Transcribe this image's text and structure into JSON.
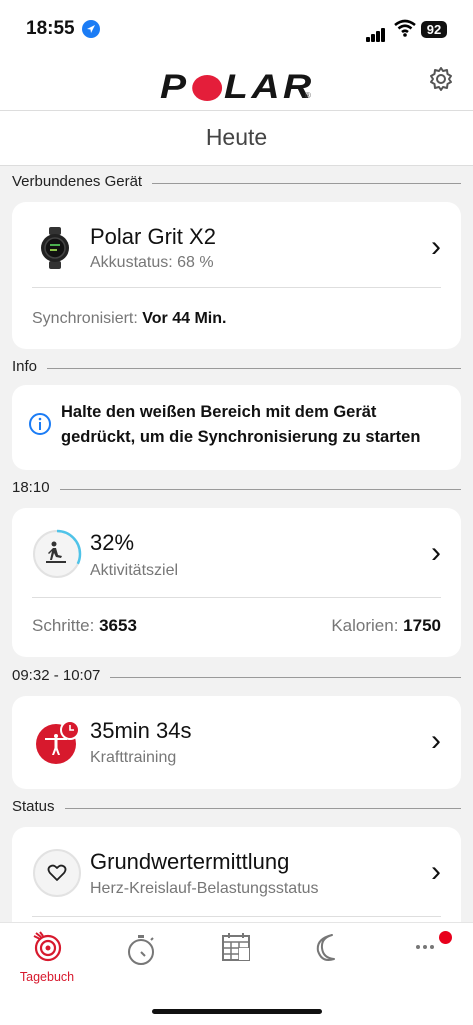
{
  "status": {
    "time": "18:55",
    "battery": "92"
  },
  "header": {
    "logo": "POLAR",
    "title": "Heute"
  },
  "sections": {
    "device": "Verbundenes Gerät",
    "info": "Info",
    "activity_time": "18:10",
    "training_time": "09:32 - 10:07",
    "status": "Status"
  },
  "device": {
    "name": "Polar Grit X2",
    "battery": "Akkustatus: 68 %",
    "sync_label": "Synchronisiert:",
    "sync_value": "Vor 44 Min."
  },
  "info": {
    "message": "Halte den weißen Bereich mit dem Gerät gedrückt, um die Synchronisierung zu starten"
  },
  "activity": {
    "percent": "32%",
    "label": "Aktivitätsziel",
    "progress": 0.32,
    "steps_label": "Schritte:",
    "steps_value": "3653",
    "calories_label": "Kalorien:",
    "calories_value": "1750"
  },
  "training": {
    "duration": "35min 34s",
    "type": "Krafttraining"
  },
  "status_card": {
    "title": "Grundwertermittlung",
    "subtitle": "Herz-Kreislauf-Belastungsstatus"
  },
  "tabbar": {
    "items": [
      {
        "label": "Tagebuch",
        "icon": "diary-icon",
        "active": true
      },
      {
        "label": "",
        "icon": "stopwatch-icon"
      },
      {
        "label": "",
        "icon": "calendar-icon"
      },
      {
        "label": "",
        "icon": "moon-icon"
      },
      {
        "label": "",
        "icon": "more-icon"
      }
    ]
  },
  "colors": {
    "accent": "#d7192d",
    "info_blue": "#1b7cf5",
    "ring": "#4fc3e8"
  }
}
